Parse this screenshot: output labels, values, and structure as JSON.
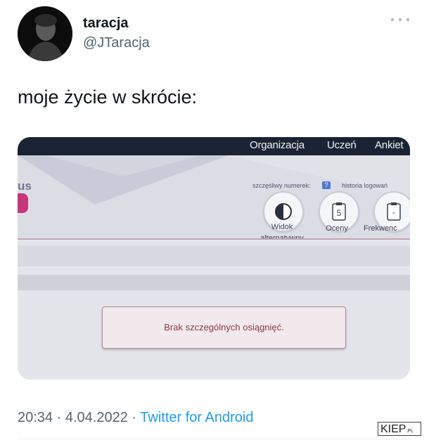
{
  "tweet": {
    "display_name": "taracja",
    "handle": "@JTaracja",
    "text": "moje życie w skrócie:",
    "time": "20:34",
    "separator": "·",
    "date": "4.04.2022",
    "source": "Twitter for Android",
    "more_icon": "more-dots-icon"
  },
  "photo": {
    "nav": [
      "Organizacja",
      "Uczeń",
      "Ankiet"
    ],
    "logo_fragment": "us",
    "lucky_number_label": "szczęśliwy numerek:",
    "lucky_number_badge": "?",
    "login_history": "historia logowań",
    "tiles": [
      {
        "label": "Widok alternatywny",
        "icon": "contrast-icon"
      },
      {
        "label": "Oceny",
        "icon": "grade-5-icon",
        "glyph": "5"
      },
      {
        "label": "Frekwenc",
        "icon": "attendance-icon",
        "glyph": "-"
      }
    ],
    "message": "Brak szczególnych osiągnięć."
  },
  "watermark": {
    "text": "KIEP",
    "suffix": ".PL"
  },
  "colors": {
    "accent": "#1d9bf0",
    "message_text": "#8a3b45",
    "topbar": "#1a2334"
  }
}
